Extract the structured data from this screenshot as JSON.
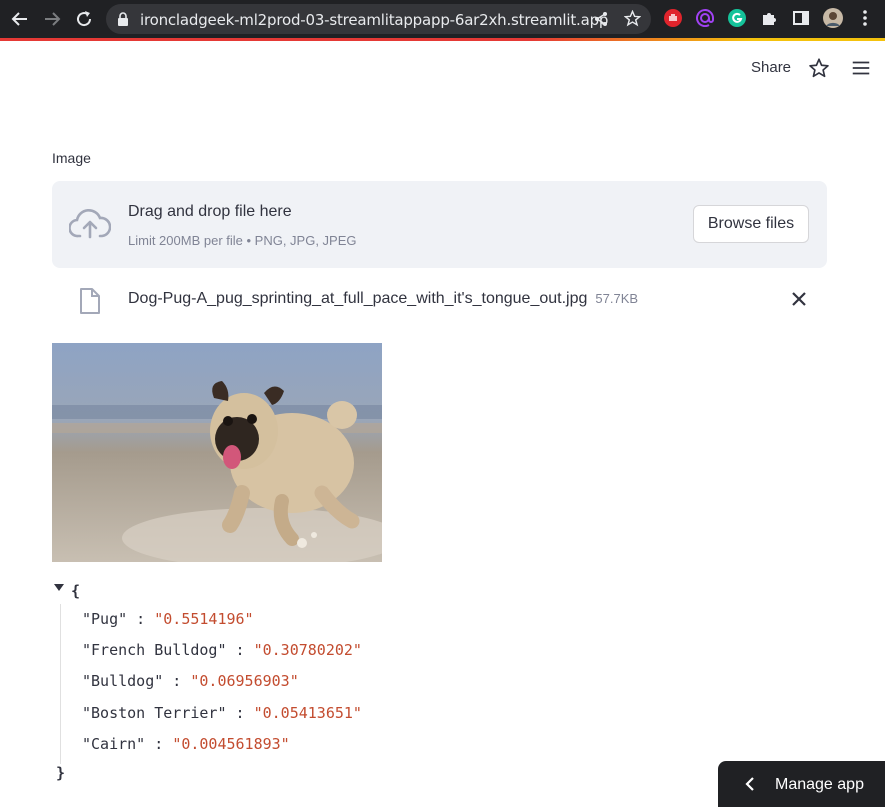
{
  "browser": {
    "url": "ironcladgeek-ml2prod-03-streamlitappapp-6ar2xh.streamlit.app",
    "extensions": [
      "stop-hand-icon",
      "at-sign-icon",
      "grammarly-icon",
      "puzzle-icon",
      "sidebar-icon",
      "avatar",
      "more-vert-icon"
    ]
  },
  "header": {
    "share_label": "Share"
  },
  "uploader": {
    "label": "Image",
    "drop_title": "Drag and drop file here",
    "drop_subtitle": "Limit 200MB per file • PNG, JPG, JPEG",
    "browse_label": "Browse files",
    "file": {
      "name": "Dog-Pug-A_pug_sprinting_at_full_pace_with_it's_tongue_out.jpg",
      "size": "57.7KB"
    }
  },
  "predictions": [
    {
      "key": "\"Pug\"",
      "value": "\"0.5514196\""
    },
    {
      "key": "\"French Bulldog\"",
      "value": "\"0.30780202\""
    },
    {
      "key": "\"Bulldog\"",
      "value": "\"0.06956903\""
    },
    {
      "key": "\"Boston Terrier\"",
      "value": "\"0.05413651\""
    },
    {
      "key": "\"Cairn\"",
      "value": "\"0.004561893\""
    }
  ],
  "json_braces": {
    "open": "{",
    "close": "}"
  },
  "footer": {
    "manage_label": "Manage app"
  },
  "colors": {
    "chrome_bg": "#202124",
    "omnibox_bg": "#35363a",
    "dropzone_bg": "#f0f2f6",
    "text": "#31333f",
    "muted": "#808495",
    "json_value": "#c34c2f"
  }
}
